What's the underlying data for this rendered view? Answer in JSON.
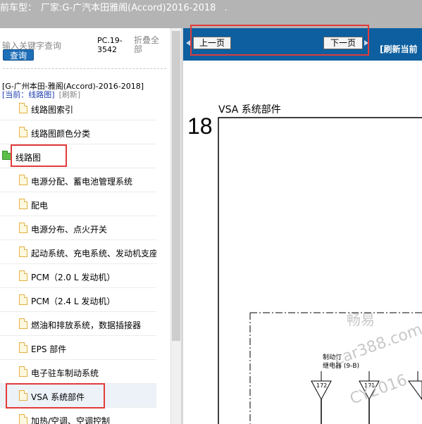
{
  "header": {
    "vehicle_label": "前车型：",
    "vehicle_value": "厂家:G-广汽本田雅阁(Accord)2016-2018",
    "dot": "."
  },
  "sidebar": {
    "search_placeholder": "输入关键字查询",
    "query_button": "查询",
    "pc_code": "PC.19-3542",
    "collapse_all": "折叠全部",
    "path": "[G-广州本田-雅阁(Accord)-2016-2018]",
    "current_label": "[当前：线路图]",
    "refresh": "[刷新]",
    "items": [
      {
        "label": "线路图索引",
        "type": "doc"
      },
      {
        "label": "线路图颜色分类",
        "type": "doc"
      },
      {
        "label": "线路图",
        "type": "folder"
      },
      {
        "label": "电源分配、蓄电池管理系统",
        "type": "doc"
      },
      {
        "label": "配电",
        "type": "doc"
      },
      {
        "label": "电源分布、点火开关",
        "type": "doc"
      },
      {
        "label": "起动系统、充电系统、发动机支座",
        "type": "doc"
      },
      {
        "label": "PCM（2.0 L 发动机）",
        "type": "doc"
      },
      {
        "label": "PCM（2.4 L 发动机）",
        "type": "doc"
      },
      {
        "label": "燃油和排放系统，数据插接器",
        "type": "doc"
      },
      {
        "label": "EPS 部件",
        "type": "doc"
      },
      {
        "label": "电子驻车制动系统",
        "type": "doc"
      },
      {
        "label": "VSA 系统部件",
        "type": "doc"
      },
      {
        "label": "加热/空调、空调控制",
        "type": "doc"
      }
    ]
  },
  "content": {
    "prev_button": "上一页",
    "next_button": "下一页",
    "refresh_current": "[刷新当前",
    "diagram": {
      "page_number": "18",
      "title": "VSA 系统部件",
      "relay_label_1": "制动灯",
      "relay_label_2": "继电器 (9-B)",
      "pin_1": "172",
      "pin_2": "171",
      "watermark_1": "畅易",
      "watermark_2": "car388.com",
      "watermark_3": "CY2016"
    }
  },
  "colors": {
    "header_bg": "#b4b4b4",
    "navbar_bg": "#0d5f9f",
    "query_button_bg": "#1e6fb7",
    "highlight": "#e23b3b",
    "selected_row_bg": "#edf2f9"
  }
}
